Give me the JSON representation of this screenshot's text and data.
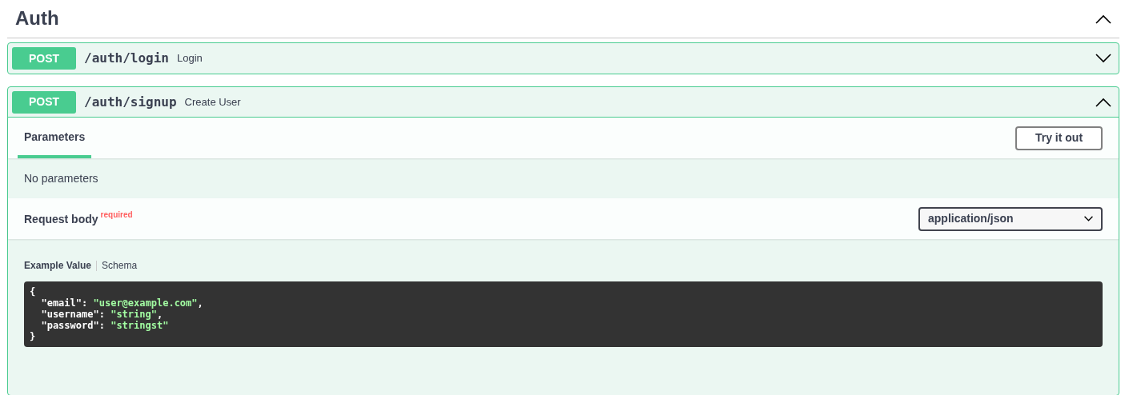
{
  "section": {
    "title": "Auth",
    "expanded": true
  },
  "operations": [
    {
      "method": "POST",
      "path": "/auth/login",
      "summary": "Login",
      "expanded": false
    },
    {
      "method": "POST",
      "path": "/auth/signup",
      "summary": "Create User",
      "expanded": true,
      "tabs": [
        {
          "label": "Parameters",
          "selected": true
        }
      ],
      "try_button": "Try it out",
      "parameters_message": "No parameters",
      "request_body": {
        "label": "Request body",
        "required_mark": "required",
        "content_type": "application/json"
      },
      "example_tabs": [
        {
          "label": "Example Value",
          "selected": true
        },
        {
          "label": "Schema",
          "selected": false
        }
      ],
      "code_lines": [
        [
          {
            "kind": "punct",
            "text": "{"
          }
        ],
        [
          {
            "kind": "key",
            "text": "  \"email\": "
          },
          {
            "kind": "string",
            "text": "\"user@example.com\""
          },
          {
            "kind": "punct",
            "text": ","
          }
        ],
        [
          {
            "kind": "key",
            "text": "  \"username\": "
          },
          {
            "kind": "string",
            "text": "\"string\""
          },
          {
            "kind": "punct",
            "text": ","
          }
        ],
        [
          {
            "kind": "key",
            "text": "  \"password\": "
          },
          {
            "kind": "string",
            "text": "\"stringst\""
          }
        ],
        [
          {
            "kind": "punct",
            "text": "}"
          }
        ]
      ]
    }
  ]
}
